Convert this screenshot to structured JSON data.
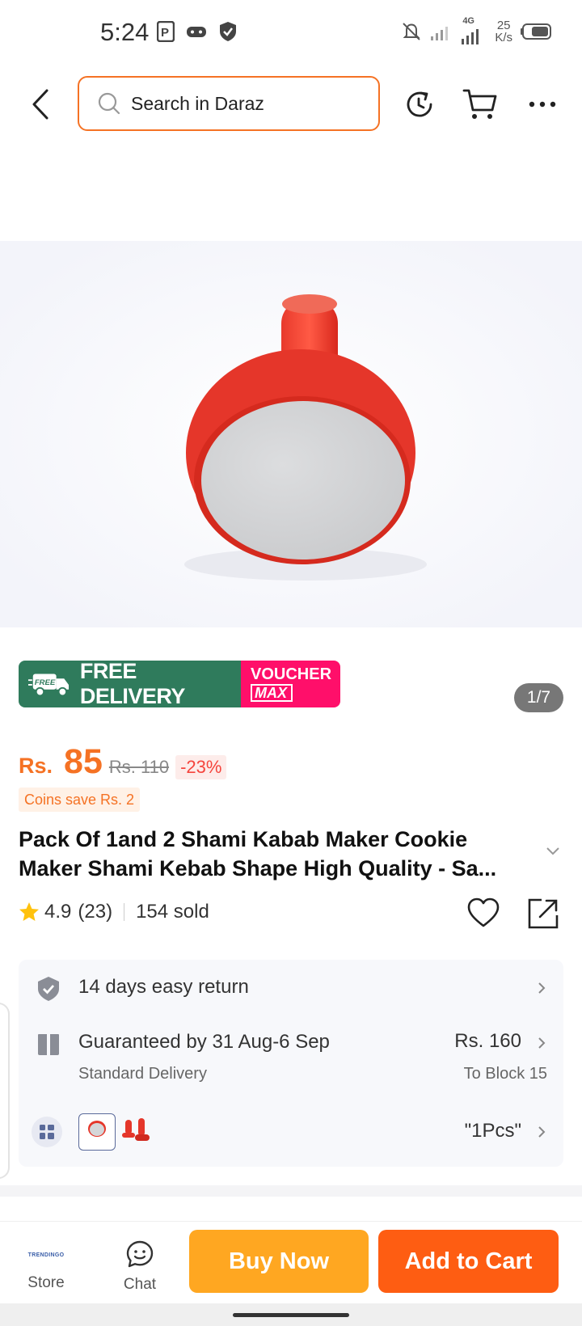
{
  "status_bar": {
    "time": "5:24",
    "net_speed_value": "25",
    "net_speed_unit": "K/s",
    "network_label": "4G"
  },
  "header": {
    "search_placeholder": "Search in Daraz",
    "accent_color": "#f57224"
  },
  "product": {
    "image_counter": "1/7",
    "banner": {
      "free_badge": "FREE",
      "free_delivery": "FREE DELIVERY",
      "voucher_line1": "VOUCHER",
      "voucher_line2": "MAX"
    },
    "price": {
      "currency": "Rs.",
      "current": "85",
      "original": "Rs. 110",
      "discount": "-23%"
    },
    "coins_note": "Coins save Rs. 2",
    "title": "Pack Of 1and 2 Shami Kabab Maker Cookie Maker Shami Kebab Shape High Quality - Sa...",
    "rating": "4.9",
    "rating_count": "(23)",
    "sold": "154 sold"
  },
  "info": {
    "return": "14 days easy return",
    "delivery_guarantee": "Guaranteed by 31 Aug-6 Sep",
    "delivery_type": "Standard Delivery",
    "delivery_price": "Rs. 160",
    "delivery_location": "To Block 15",
    "variant_selected": "\"1Pcs\""
  },
  "bottom_bar": {
    "store_logo_text": "TRENDINGO",
    "store_label": "Store",
    "chat_label": "Chat",
    "buy_now": "Buy Now",
    "add_to_cart": "Add to Cart",
    "buy_color": "#ffa721",
    "cart_color": "#fe5d12"
  }
}
